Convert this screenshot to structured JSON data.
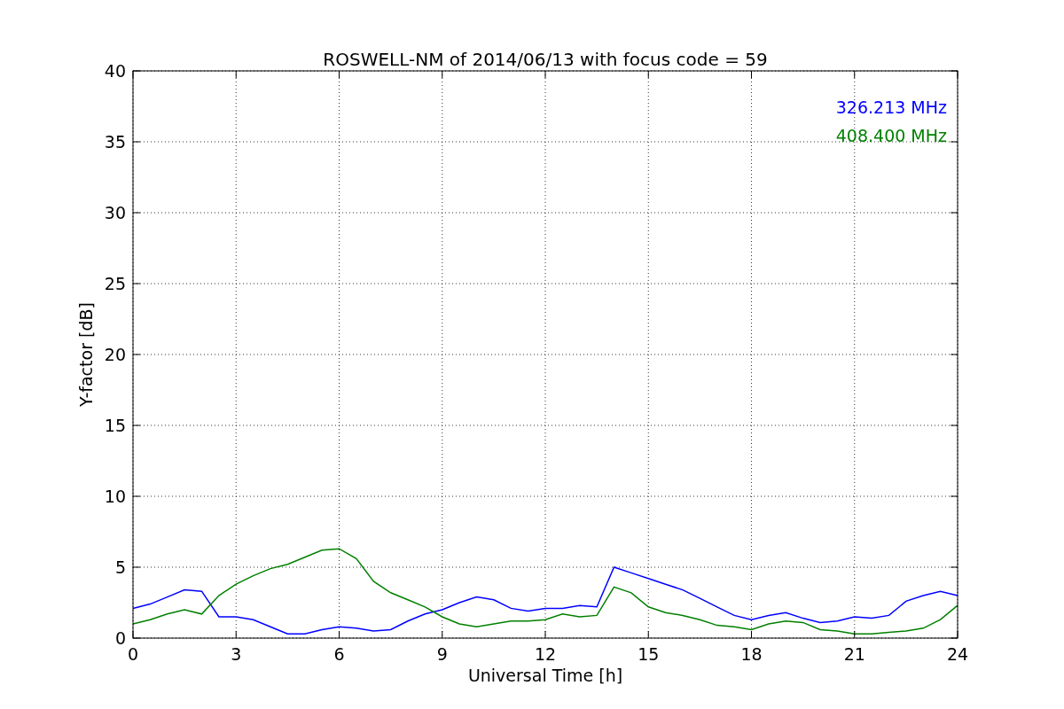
{
  "chart_data": {
    "type": "line",
    "title": "ROSWELL-NM of 2014/06/13 with focus code = 59",
    "xlabel": "Universal Time [h]",
    "ylabel": "Y-factor [dB]",
    "x": [
      0,
      0.5,
      1,
      1.5,
      2,
      2.5,
      3,
      3.5,
      4,
      4.5,
      5,
      5.5,
      6,
      6.5,
      7,
      7.5,
      8,
      8.5,
      9,
      9.5,
      10,
      10.5,
      11,
      11.5,
      12,
      12.5,
      13,
      13.5,
      14,
      14.5,
      15,
      15.5,
      16,
      16.5,
      17,
      17.5,
      18,
      18.5,
      19,
      19.5,
      20,
      20.5,
      21,
      21.5,
      22,
      22.5,
      23,
      23.5,
      24
    ],
    "series": [
      {
        "name": "326.213 MHz",
        "color": "#0000ff",
        "values": [
          2.1,
          2.4,
          2.9,
          3.4,
          3.3,
          1.5,
          1.5,
          1.3,
          0.8,
          0.3,
          0.3,
          0.6,
          0.8,
          0.7,
          0.5,
          0.6,
          1.2,
          1.7,
          2.0,
          2.5,
          2.9,
          2.7,
          2.1,
          1.9,
          2.1,
          2.1,
          2.3,
          2.2,
          5.0,
          4.6,
          4.2,
          3.8,
          3.4,
          2.8,
          2.2,
          1.6,
          1.3,
          1.6,
          1.8,
          1.4,
          1.1,
          1.2,
          1.5,
          1.4,
          1.6,
          2.6,
          3.0,
          3.3,
          3.0
        ]
      },
      {
        "name": "408.400 MHz",
        "color": "#008000",
        "values": [
          1.0,
          1.3,
          1.7,
          2.0,
          1.7,
          3.0,
          3.8,
          4.4,
          4.9,
          5.2,
          5.7,
          6.2,
          6.3,
          5.6,
          4.0,
          3.2,
          2.7,
          2.2,
          1.5,
          1.0,
          0.8,
          1.0,
          1.2,
          1.2,
          1.3,
          1.7,
          1.5,
          1.6,
          3.6,
          3.2,
          2.2,
          1.8,
          1.6,
          1.3,
          0.9,
          0.8,
          0.6,
          1.0,
          1.2,
          1.1,
          0.6,
          0.5,
          0.3,
          0.3,
          0.4,
          0.5,
          0.7,
          1.3,
          2.3
        ]
      }
    ],
    "grid": true,
    "xlim": [
      0,
      24
    ],
    "ylim": [
      0,
      40
    ],
    "xticks": [
      0,
      3,
      6,
      9,
      12,
      15,
      18,
      21,
      24
    ],
    "yticks": [
      0,
      5,
      10,
      15,
      20,
      25,
      30,
      35,
      40
    ]
  }
}
